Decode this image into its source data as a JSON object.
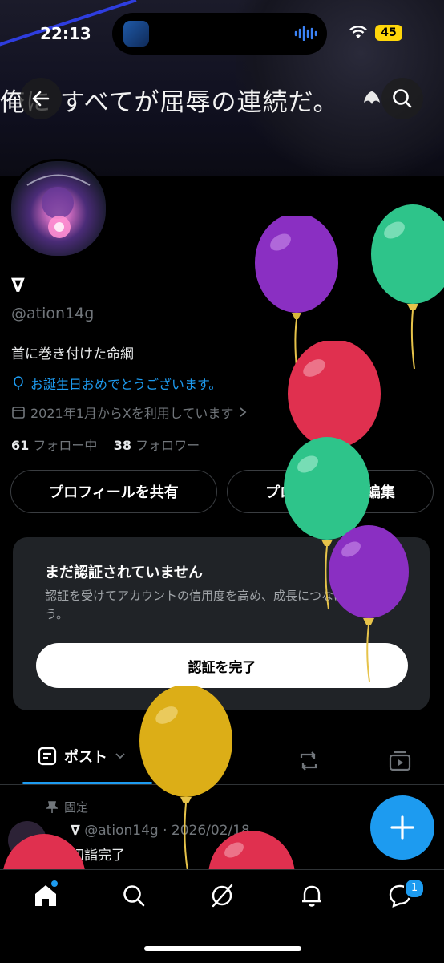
{
  "status_bar": {
    "time": "22:13",
    "battery": "45"
  },
  "header": {
    "banner_text": "俺に すべてが屈辱の連続だ。"
  },
  "profile": {
    "display_name": "∇",
    "handle": "@ation14g",
    "bio": "首に巻き付けた命綱",
    "birthday": "お誕生日おめでとうございます。",
    "joined": "2021年1月からXを利用しています",
    "following_count": "61",
    "following_label": "フォロー中",
    "followers_count": "38",
    "followers_label": "フォロワー"
  },
  "actions": {
    "share": "プロフィールを共有",
    "edit": "プロフィールを編集"
  },
  "verify": {
    "title": "まだ認証されていません",
    "body": "認証を受けてアカウントの信用度を高め、成長につなげましょう。",
    "button": "認証を完了",
    "close": "×"
  },
  "tabs": {
    "posts": "ポスト"
  },
  "pinned_post": {
    "pinned_label": "固定",
    "author": "∇",
    "handle_date": "@ation14g · 2026/02/18",
    "text": "初詣完了"
  },
  "nav": {
    "messages_badge": "1"
  },
  "colors": {
    "accent": "#1d9bf0",
    "card": "#202327",
    "battery": "#ffd60a"
  }
}
